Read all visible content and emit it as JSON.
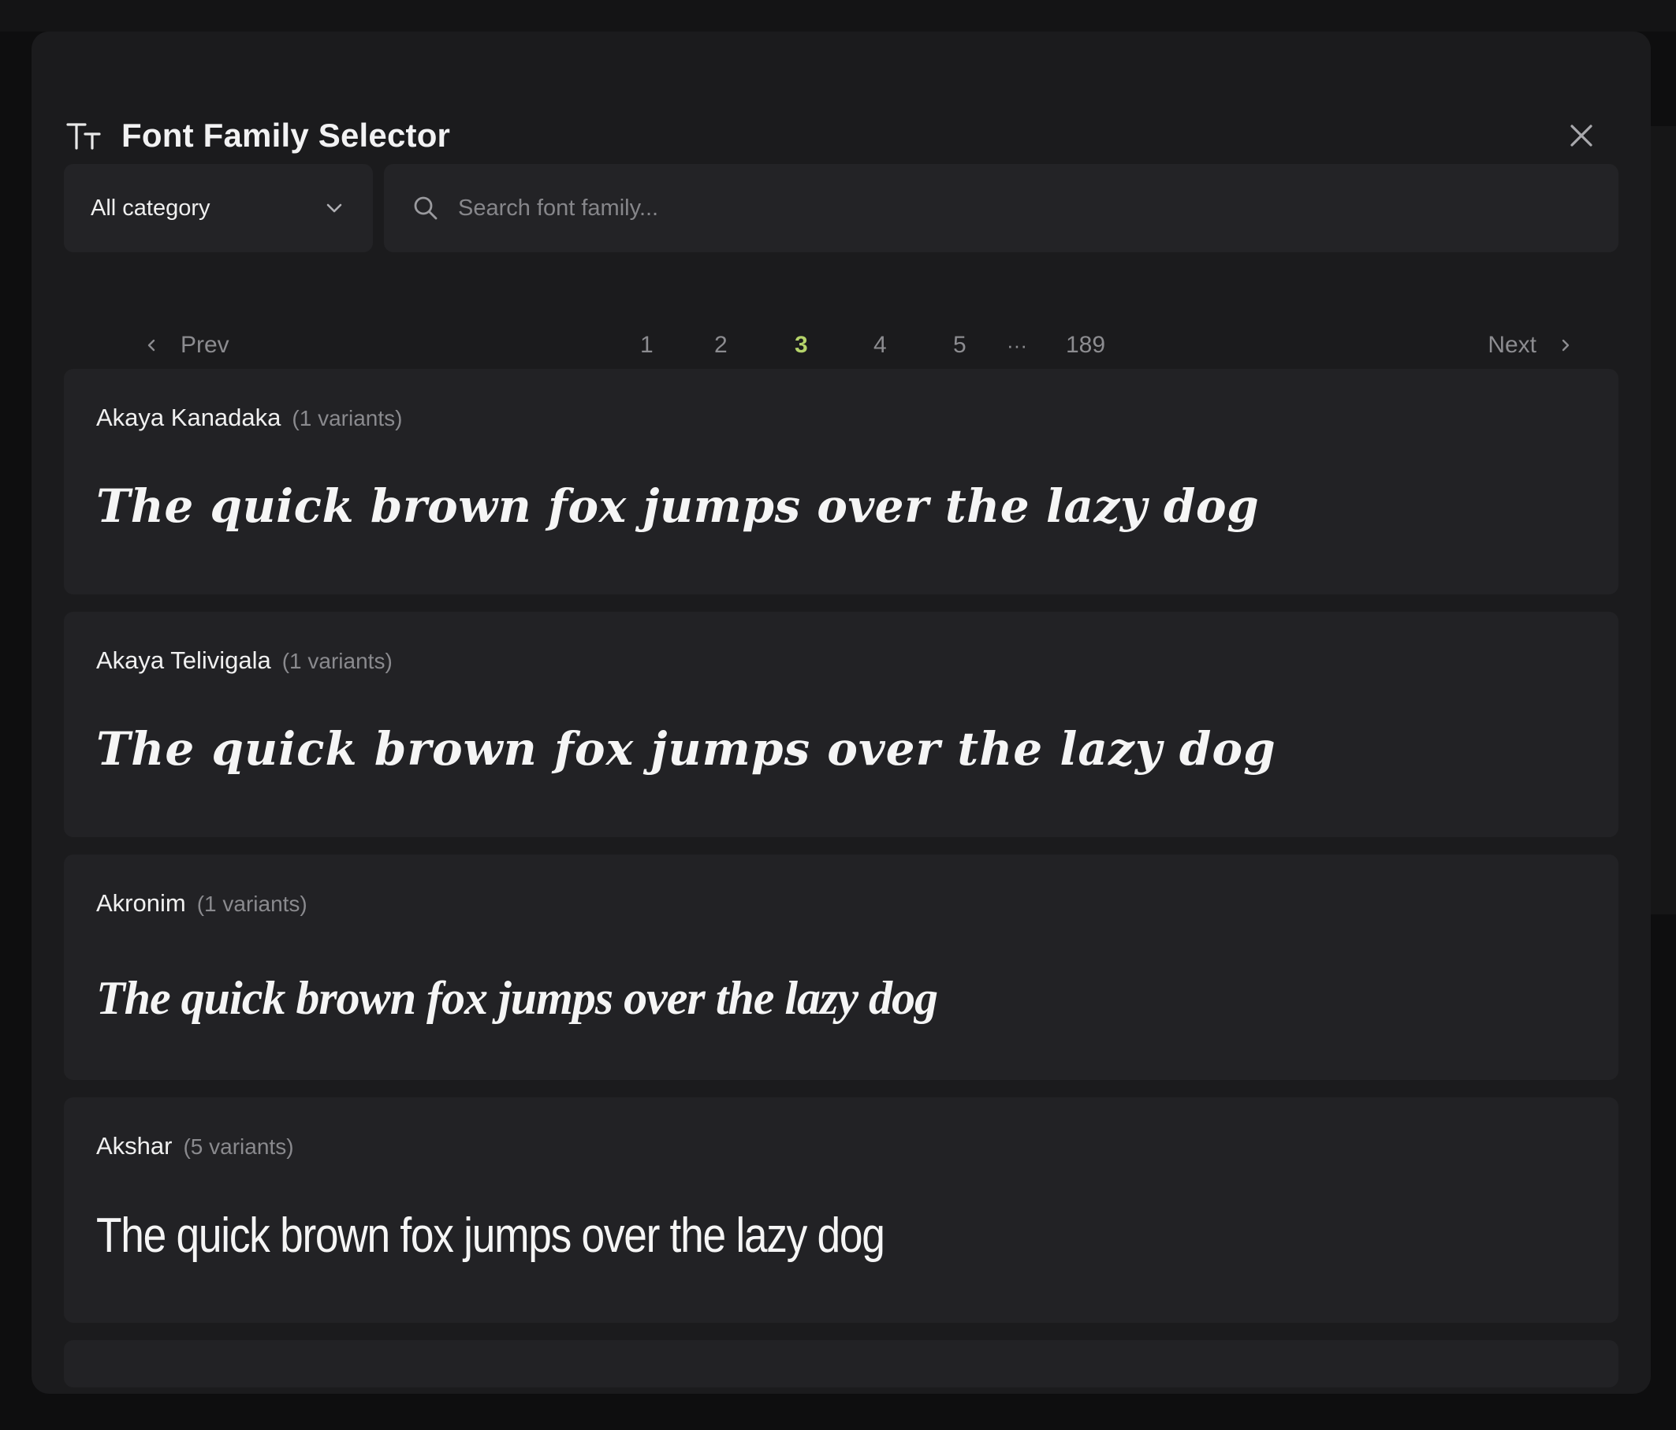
{
  "modal": {
    "title": "Font Family Selector",
    "title_icon": "text-size-icon",
    "close_icon": "close-icon"
  },
  "filters": {
    "category_value": "All category",
    "search_placeholder": "Search font family...",
    "search_value": ""
  },
  "pagination": {
    "prev_label": "Prev",
    "next_label": "Next",
    "pages": [
      "1",
      "2",
      "3",
      "4",
      "5"
    ],
    "ellipsis": "···",
    "last_page": "189",
    "current_page": "3",
    "active_color": "#b5d36a"
  },
  "fonts": [
    {
      "name": "Akaya Kanadaka",
      "variants": "(1 variants)",
      "sample": "The quick brown fox jumps over the lazy dog"
    },
    {
      "name": "Akaya Telivigala",
      "variants": "(1 variants)",
      "sample": "The quick brown fox jumps over the lazy dog"
    },
    {
      "name": "Akronim",
      "variants": "(1 variants)",
      "sample": "The quick brown fox jumps over the lazy dog"
    },
    {
      "name": "Akshar",
      "variants": "(5 variants)",
      "sample": "The quick brown fox jumps over the lazy dog"
    }
  ]
}
